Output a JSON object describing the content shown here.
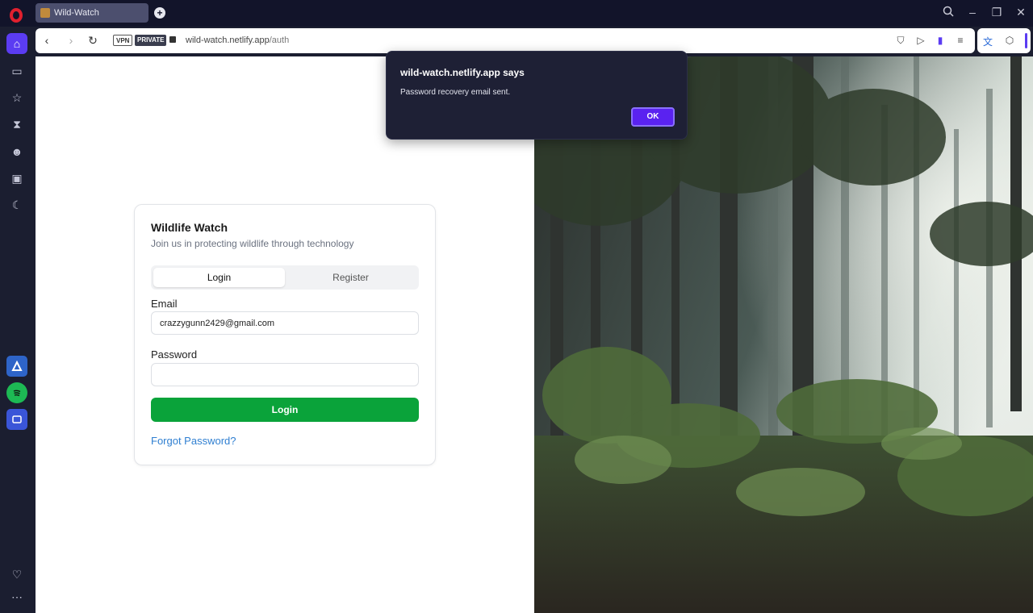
{
  "browser": {
    "tab_title": "Wild-Watch",
    "vpn_label": "VPN",
    "private_label": "PRIVATE",
    "url_host": "wild-watch.netlify.app",
    "url_path": "/auth"
  },
  "card": {
    "title": "Wildlife Watch",
    "subtitle": "Join us in protecting wildlife through technology",
    "tab_login": "Login",
    "tab_register": "Register",
    "email_label": "Email",
    "email_value": "crazzygunn2429@gmail.com",
    "password_label": "Password",
    "password_value": "",
    "login_button": "Login",
    "forgot_link": "Forgot Password?"
  },
  "dialog": {
    "title": "wild-watch.netlify.app says",
    "message": "Password recovery email sent.",
    "ok": "OK"
  },
  "colors": {
    "accent": "#5b3cf2",
    "login_button": "#0aa33a",
    "link": "#2f7fd1",
    "dialog_bg": "#1e2035"
  }
}
